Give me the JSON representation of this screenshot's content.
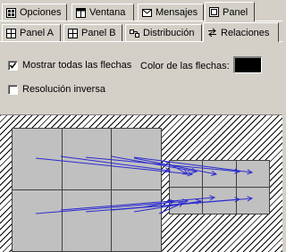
{
  "tabs_top": [
    {
      "label": "Opciones",
      "icon": "options-icon"
    },
    {
      "label": "Ventana",
      "icon": "window-icon"
    },
    {
      "label": "Mensajes",
      "icon": "messages-icon"
    },
    {
      "label": "Panel",
      "icon": "panel-icon",
      "active": true
    }
  ],
  "tabs_sub": [
    {
      "label": "Panel A",
      "icon": "grid-icon"
    },
    {
      "label": "Panel B",
      "icon": "grid-icon"
    },
    {
      "label": "Distribución",
      "icon": "distribution-icon"
    },
    {
      "label": "Relaciones",
      "icon": "relations-icon",
      "active": true
    }
  ],
  "options": {
    "show_all_arrows": {
      "label": "Mostrar todas las flechas",
      "checked": true
    },
    "arrow_color_label": "Color de las flechas:",
    "arrow_color": "#000000",
    "inverse_resolution": {
      "label": "Resolución inversa",
      "checked": false
    }
  },
  "preview": {
    "grid_a": {
      "rows": 2,
      "cols": 3
    },
    "grid_b": {
      "rows": 2,
      "cols": 3
    },
    "arrow_color": "#2b2bd0"
  }
}
